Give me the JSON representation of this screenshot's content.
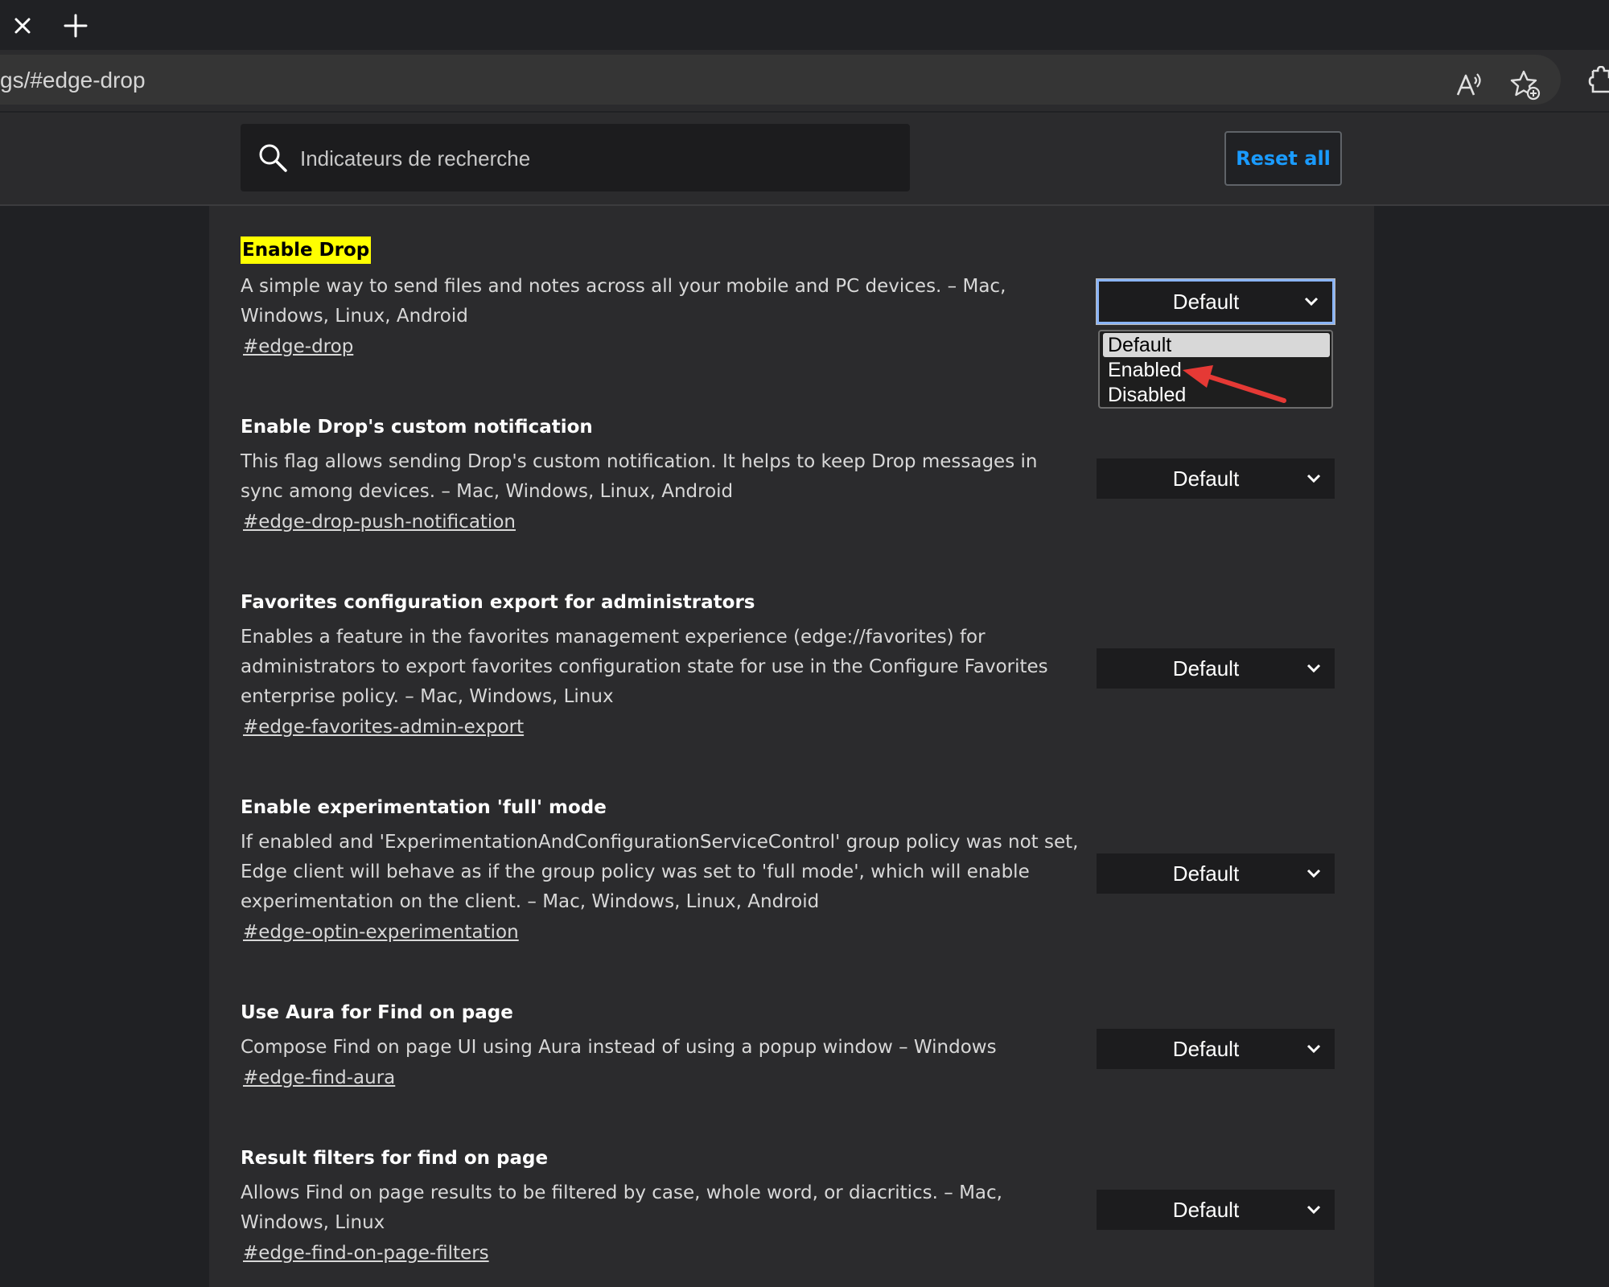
{
  "address_bar": {
    "url": "gs/#edge-drop"
  },
  "search": {
    "placeholder": "Indicateurs de recherche"
  },
  "header": {
    "reset_label": "Reset all"
  },
  "colors": {
    "highlight": "#ffff00",
    "accent_link": "#1a9bff",
    "annotation_arrow": "#e53935"
  },
  "flags": [
    {
      "title": "Enable Drop",
      "description": "A simple way to send files and notes across all your mobile and PC devices. – Mac, Windows, Linux, Android",
      "link": "#edge-drop",
      "value": "Default"
    },
    {
      "title": "Enable Drop's custom notification",
      "description": "This flag allows sending Drop's custom notification. It helps to keep Drop messages in sync among devices. – Mac, Windows, Linux, Android",
      "link": "#edge-drop-push-notification",
      "value": "Default"
    },
    {
      "title": "Favorites configuration export for administrators",
      "description": "Enables a feature in the favorites management experience (edge://favorites) for administrators to export favorites configuration state for use in the Configure Favorites enterprise policy. – Mac, Windows, Linux",
      "link": "#edge-favorites-admin-export",
      "value": "Default"
    },
    {
      "title": "Enable experimentation 'full' mode",
      "description": "If enabled and 'ExperimentationAndConfigurationServiceControl' group policy was not set, Edge client will behave as if the group policy was set to 'full mode', which will enable experimentation on the client. – Mac, Windows, Linux, Android",
      "link": "#edge-optin-experimentation",
      "value": "Default"
    },
    {
      "title": "Use Aura for Find on page",
      "description": "Compose Find on page UI using Aura instead of using a popup window – Windows",
      "link": "#edge-find-aura",
      "value": "Default"
    },
    {
      "title": "Result filters for find on page",
      "description": "Allows Find on page results to be filtered by case, whole word, or diacritics. – Mac, Windows, Linux",
      "link": "#edge-find-on-page-filters",
      "value": "Default"
    }
  ],
  "dropdown": {
    "options": [
      "Default",
      "Enabled",
      "Disabled"
    ],
    "selected": "Default"
  }
}
